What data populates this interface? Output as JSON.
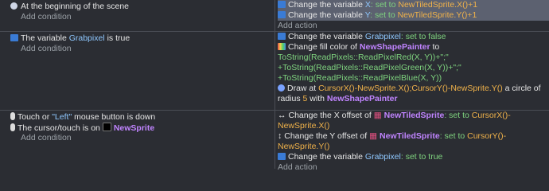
{
  "events": [
    {
      "conditions": [
        {
          "prefix": "At the beginning of the scene",
          "var": "",
          "suffix": ""
        }
      ],
      "add_condition": "Add condition",
      "actions": [
        {
          "pre": "Change the variable ",
          "obj": "X",
          "mid": ": set to ",
          "val": "NewTiledSprite.X()+1"
        },
        {
          "pre": "Change the variable ",
          "obj": "Y",
          "mid": ": set to ",
          "val": "NewTiledSprite.Y()+1"
        }
      ],
      "add_action": "Add action"
    },
    {
      "conditions": [
        {
          "prefix": "The variable ",
          "var": "Grabpixel",
          "suffix": " is true"
        }
      ],
      "add_condition": "Add condition",
      "actions": [
        {
          "pre": "Change the variable ",
          "obj": "Grabpixel",
          "mid": ": set to false"
        },
        {
          "pre": "Change fill color of ",
          "obj": "NewShapePainter",
          "mid": " to"
        },
        {
          "expr": "ToString(ReadPixels::ReadPixelRed(X, Y))+\";\""
        },
        {
          "expr": "+ToString(ReadPixels::ReadPixelGreen(X, Y))+\";\""
        },
        {
          "expr": "+ToString(ReadPixels::ReadPixelBlue(X, Y))"
        },
        {
          "pre": "Draw at ",
          "val": "CursorX()-NewSprite.X();CursorY()-NewSprite.Y()",
          "mid": " a circle of"
        },
        {
          "pre": "radius ",
          "val": "5",
          "mid": " with ",
          "obj": "NewShapePainter"
        }
      ],
      "add_action": ""
    },
    {
      "conditions": [
        {
          "prefix": "Touch or ",
          "val": "\"Left\"",
          "suffix": " mouse button is down"
        },
        {
          "prefix": "The cursor/touch is on ",
          "obj": "NewSprite"
        }
      ],
      "add_condition": "Add condition",
      "actions": [
        {
          "pre": "Change the X offset of ",
          "obj": "NewTiledSprite",
          "mid": ": set to ",
          "val": "CursorX()-"
        },
        {
          "val": "NewSprite.X()"
        },
        {
          "pre": "Change the Y offset of ",
          "obj": "NewTiledSprite",
          "mid": ": set to ",
          "val": "CursorY()-"
        },
        {
          "val": "NewSprite.Y()"
        },
        {
          "pre": "Change the variable ",
          "obj": "Grabpixel",
          "mid": ": set to true"
        }
      ],
      "add_action": "Add action"
    }
  ]
}
